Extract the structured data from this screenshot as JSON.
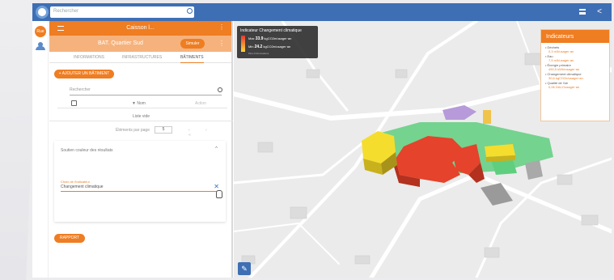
{
  "topbar": {
    "search_placeholder": "Rechercher",
    "menu_icon": "menu-icon",
    "share_icon": "share-icon"
  },
  "rail": {
    "badge": "Rue"
  },
  "panel": {
    "title": "Caisson l...",
    "subtitle": "BAT. Quartier Sud",
    "sub_button": "Simuler",
    "tabs": [
      "INFORMATIONS",
      "INFRASTRUCTURES",
      "BÂTIMENTS"
    ],
    "add_button": "+ AJOUTER UN BÂTIMENT",
    "search_placeholder": "Rechercher",
    "row_mid": "▼ Nom",
    "row_right": "Action",
    "list_label": "Liste vide",
    "pager_label": "Éléments par page",
    "pager_value": "5",
    "pager_nav": "‹ › «",
    "expander_head": "Soutien couleur des résultats",
    "field_label": "Choix de l'indicateur",
    "field_value": "Changement climatique",
    "report_button": "RAPPORT"
  },
  "legend": {
    "title": "Indicateur Changement climatique",
    "max_label": "Max",
    "max_value": "33.9",
    "max_unit": "kgCO2e/usager·an",
    "min_label": "Min",
    "min_value": "24.2",
    "min_unit": "kgCO2e/usager·an",
    "footer": "Plus d'informations"
  },
  "indicators": {
    "title": "Indicateurs",
    "items": [
      {
        "name": "Déchets",
        "value": "0,3 m3/usager·an"
      },
      {
        "name": "Eau",
        "value": "7,5 m3/usager·an"
      },
      {
        "name": "Énergie primaire",
        "value": "490,5 kWh/usager·an"
      },
      {
        "name": "Changement climatique",
        "value": "30,6 kgCO2e/usager·an"
      },
      {
        "name": "Qualité de l'air",
        "value": "0,06 DALY/usager·an"
      }
    ]
  },
  "colors": {
    "accent": "#ef7d22",
    "brand": "#3e6fb5"
  }
}
